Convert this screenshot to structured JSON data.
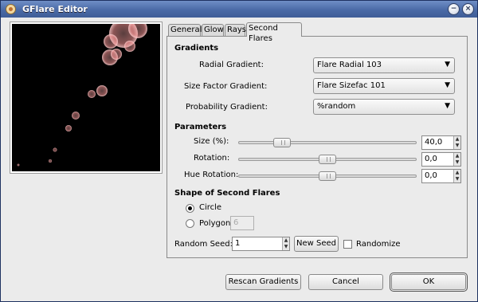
{
  "window": {
    "title": "GFlare Editor"
  },
  "title_buttons": {
    "minimize": "−",
    "close": "×"
  },
  "tabs": [
    {
      "label": "General",
      "active": false
    },
    {
      "label": "Glow",
      "active": false
    },
    {
      "label": "Rays",
      "active": false
    },
    {
      "label": "Second Flares",
      "active": true
    }
  ],
  "gradients": {
    "title": "Gradients",
    "radial_label": "Radial Gradient:",
    "radial_value": "Flare Radial 103",
    "size_label": "Size Factor Gradient:",
    "size_value": "Flare Sizefac 101",
    "prob_label": "Probability Gradient:",
    "prob_value": "%random"
  },
  "parameters": {
    "title": "Parameters",
    "size_label": "Size (%):",
    "size_value": "40,0",
    "size_fraction": 0.22,
    "rotation_label": "Rotation:",
    "rotation_value": "0,0",
    "rotation_fraction": 0.5,
    "hue_label": "Hue Rotation:",
    "hue_value": "0,0",
    "hue_fraction": 0.5
  },
  "shape": {
    "title": "Shape of Second Flares",
    "circle_label": "Circle",
    "circle_selected": true,
    "polygon_label": "Polygon",
    "polygon_value": "6"
  },
  "seed": {
    "label": "Random Seed:",
    "value": "1",
    "new_seed": "New Seed",
    "randomize_label": "Randomize"
  },
  "footer": {
    "rescan": "Rescan Gradients",
    "cancel": "Cancel",
    "ok": "OK"
  },
  "icons": {
    "arrow": "▼",
    "spin_up": "▲",
    "spin_down": "▼"
  }
}
